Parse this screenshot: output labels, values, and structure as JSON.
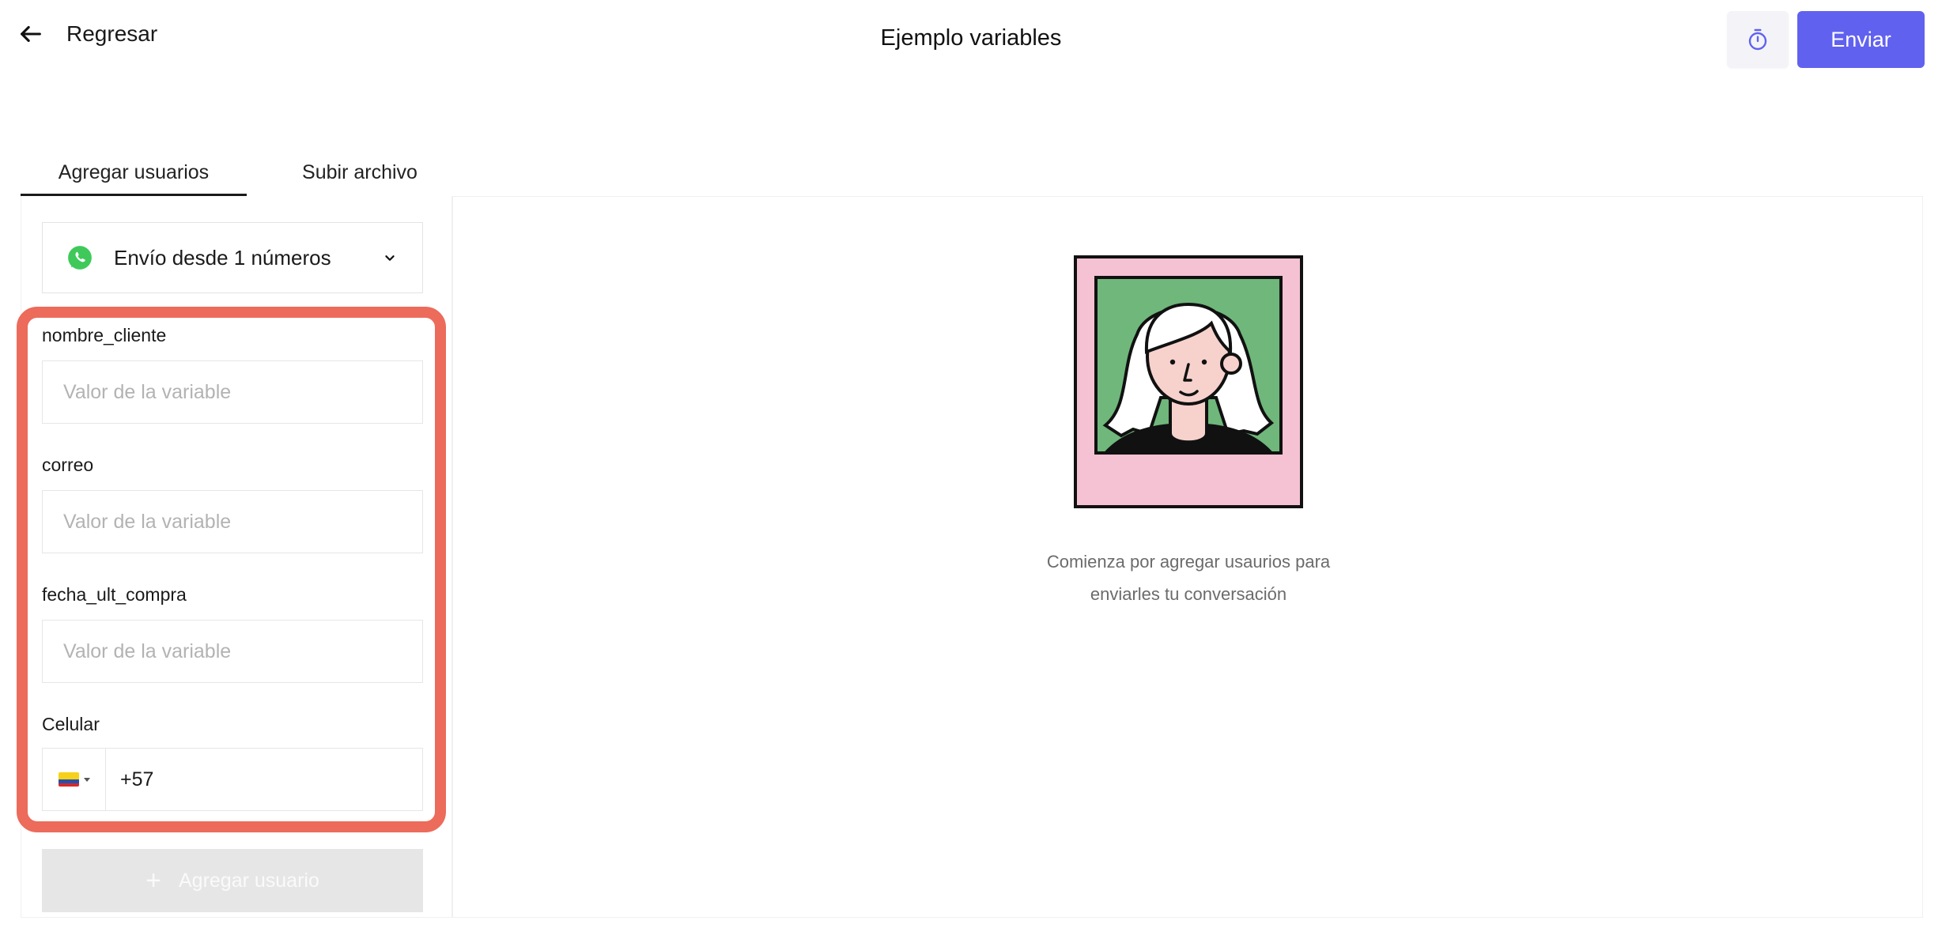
{
  "header": {
    "back_label": "Regresar",
    "title": "Ejemplo variables",
    "send_label": "Enviar",
    "icons": {
      "back": "arrow-left-icon",
      "timer": "stopwatch-icon"
    },
    "colors": {
      "primary": "#6161f0",
      "highlight": "#ec6b5b"
    }
  },
  "tabs": [
    {
      "label": "Agregar usuarios",
      "active": true
    },
    {
      "label": "Subir archivo",
      "active": false
    }
  ],
  "sender": {
    "label": "Envío desde 1 números",
    "icon": "whatsapp-icon"
  },
  "fields": [
    {
      "label": "nombre_cliente",
      "value": "",
      "placeholder": "Valor de la variable"
    },
    {
      "label": "correo",
      "value": "",
      "placeholder": "Valor de la variable"
    },
    {
      "label": "fecha_ult_compra",
      "value": "",
      "placeholder": "Valor de la variable"
    }
  ],
  "phone": {
    "label": "Celular",
    "value": "+57",
    "country": "CO",
    "flag_icon": "colombia-flag-icon"
  },
  "add_user": {
    "label": "Agregar usuario",
    "enabled": false
  },
  "empty_state": {
    "line1": "Comienza por agregar usaurios para",
    "line2": "enviarles tu conversación"
  }
}
